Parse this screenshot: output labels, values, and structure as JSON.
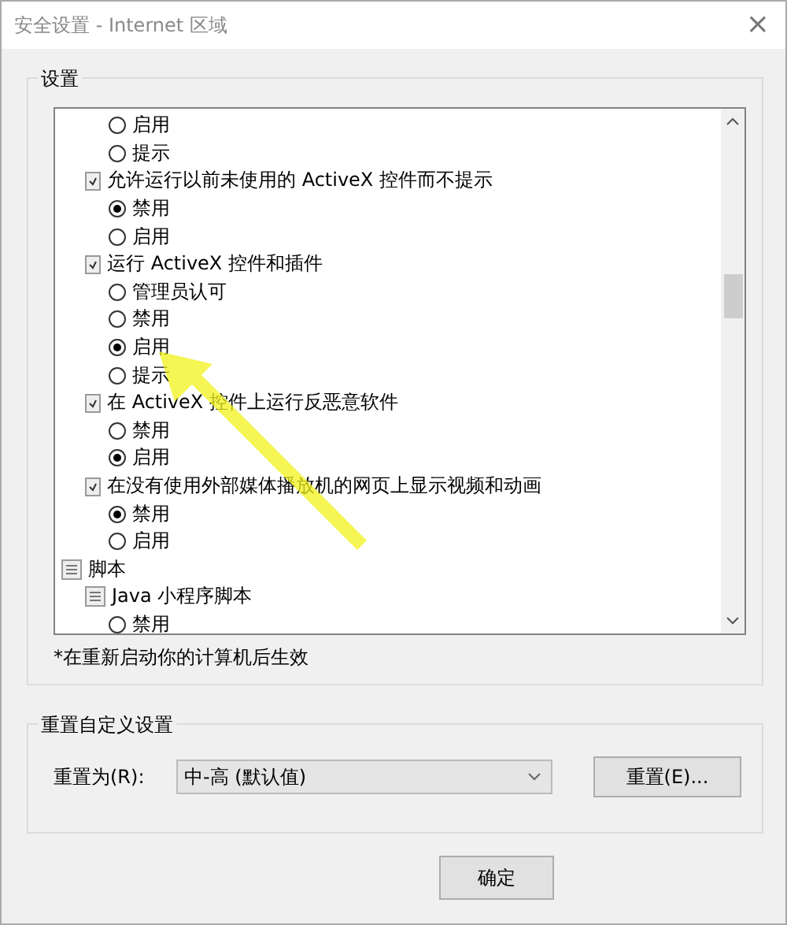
{
  "window": {
    "title": "安全设置 - Internet 区域",
    "close": "×"
  },
  "settings_group": {
    "title": "设置",
    "tree": [
      {
        "kind": "continued",
        "children": [
          {
            "kind": "continued",
            "children": [
              {
                "kind": "option",
                "label": "启用",
                "selected": false
              },
              {
                "kind": "option",
                "label": "提示",
                "selected": false
              }
            ]
          },
          {
            "kind": "setting",
            "label": "允许运行以前未使用的 ActiveX 控件而不提示",
            "children": [
              {
                "kind": "option",
                "label": "禁用",
                "selected": true
              },
              {
                "kind": "option",
                "label": "启用",
                "selected": false
              }
            ]
          },
          {
            "kind": "setting",
            "label": "运行 ActiveX 控件和插件",
            "children": [
              {
                "kind": "option",
                "label": "管理员认可",
                "selected": false
              },
              {
                "kind": "option",
                "label": "禁用",
                "selected": false
              },
              {
                "kind": "option",
                "label": "启用",
                "selected": true
              },
              {
                "kind": "option",
                "label": "提示",
                "selected": false
              }
            ]
          },
          {
            "kind": "setting",
            "label": "在 ActiveX 控件上运行反恶意软件",
            "children": [
              {
                "kind": "option",
                "label": "禁用",
                "selected": false
              },
              {
                "kind": "option",
                "label": "启用",
                "selected": true
              }
            ]
          },
          {
            "kind": "setting",
            "label": "在没有使用外部媒体播放机的网页上显示视频和动画",
            "children": [
              {
                "kind": "option",
                "label": "禁用",
                "selected": true
              },
              {
                "kind": "option",
                "label": "启用",
                "selected": false
              }
            ]
          }
        ]
      },
      {
        "kind": "category",
        "label": "脚本",
        "children": [
          {
            "kind": "category",
            "label": "Java 小程序脚本",
            "children": [
              {
                "kind": "option",
                "label": "禁用",
                "selected": false
              }
            ]
          }
        ]
      }
    ],
    "note": "*在重新启动你的计算机后生效"
  },
  "reset_group": {
    "title": "重置自定义设置",
    "label": "重置为(R):",
    "value": "中-高 (默认值)",
    "button": "重置(E)..."
  },
  "buttons": [
    "确定"
  ]
}
